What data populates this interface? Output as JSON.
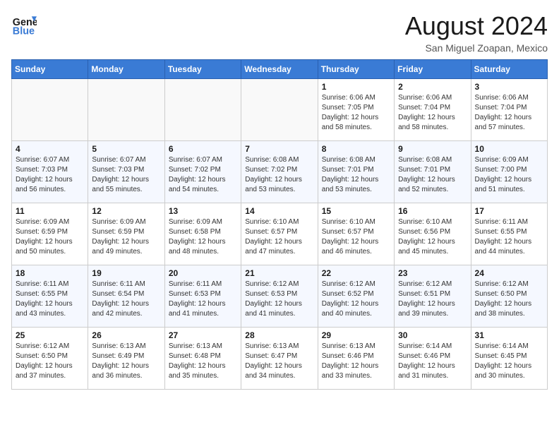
{
  "header": {
    "logo_line1": "General",
    "logo_line2": "Blue",
    "month_year": "August 2024",
    "location": "San Miguel Zoapan, Mexico"
  },
  "weekdays": [
    "Sunday",
    "Monday",
    "Tuesday",
    "Wednesday",
    "Thursday",
    "Friday",
    "Saturday"
  ],
  "weeks": [
    [
      {
        "day": "",
        "empty": true
      },
      {
        "day": "",
        "empty": true
      },
      {
        "day": "",
        "empty": true
      },
      {
        "day": "",
        "empty": true
      },
      {
        "day": "1",
        "sunrise": "6:06 AM",
        "sunset": "7:05 PM",
        "daylight": "12 hours and 58 minutes."
      },
      {
        "day": "2",
        "sunrise": "6:06 AM",
        "sunset": "7:04 PM",
        "daylight": "12 hours and 58 minutes."
      },
      {
        "day": "3",
        "sunrise": "6:06 AM",
        "sunset": "7:04 PM",
        "daylight": "12 hours and 57 minutes."
      }
    ],
    [
      {
        "day": "4",
        "sunrise": "6:07 AM",
        "sunset": "7:03 PM",
        "daylight": "12 hours and 56 minutes."
      },
      {
        "day": "5",
        "sunrise": "6:07 AM",
        "sunset": "7:03 PM",
        "daylight": "12 hours and 55 minutes."
      },
      {
        "day": "6",
        "sunrise": "6:07 AM",
        "sunset": "7:02 PM",
        "daylight": "12 hours and 54 minutes."
      },
      {
        "day": "7",
        "sunrise": "6:08 AM",
        "sunset": "7:02 PM",
        "daylight": "12 hours and 53 minutes."
      },
      {
        "day": "8",
        "sunrise": "6:08 AM",
        "sunset": "7:01 PM",
        "daylight": "12 hours and 53 minutes."
      },
      {
        "day": "9",
        "sunrise": "6:08 AM",
        "sunset": "7:01 PM",
        "daylight": "12 hours and 52 minutes."
      },
      {
        "day": "10",
        "sunrise": "6:09 AM",
        "sunset": "7:00 PM",
        "daylight": "12 hours and 51 minutes."
      }
    ],
    [
      {
        "day": "11",
        "sunrise": "6:09 AM",
        "sunset": "6:59 PM",
        "daylight": "12 hours and 50 minutes."
      },
      {
        "day": "12",
        "sunrise": "6:09 AM",
        "sunset": "6:59 PM",
        "daylight": "12 hours and 49 minutes."
      },
      {
        "day": "13",
        "sunrise": "6:09 AM",
        "sunset": "6:58 PM",
        "daylight": "12 hours and 48 minutes."
      },
      {
        "day": "14",
        "sunrise": "6:10 AM",
        "sunset": "6:57 PM",
        "daylight": "12 hours and 47 minutes."
      },
      {
        "day": "15",
        "sunrise": "6:10 AM",
        "sunset": "6:57 PM",
        "daylight": "12 hours and 46 minutes."
      },
      {
        "day": "16",
        "sunrise": "6:10 AM",
        "sunset": "6:56 PM",
        "daylight": "12 hours and 45 minutes."
      },
      {
        "day": "17",
        "sunrise": "6:11 AM",
        "sunset": "6:55 PM",
        "daylight": "12 hours and 44 minutes."
      }
    ],
    [
      {
        "day": "18",
        "sunrise": "6:11 AM",
        "sunset": "6:55 PM",
        "daylight": "12 hours and 43 minutes."
      },
      {
        "day": "19",
        "sunrise": "6:11 AM",
        "sunset": "6:54 PM",
        "daylight": "12 hours and 42 minutes."
      },
      {
        "day": "20",
        "sunrise": "6:11 AM",
        "sunset": "6:53 PM",
        "daylight": "12 hours and 41 minutes."
      },
      {
        "day": "21",
        "sunrise": "6:12 AM",
        "sunset": "6:53 PM",
        "daylight": "12 hours and 41 minutes."
      },
      {
        "day": "22",
        "sunrise": "6:12 AM",
        "sunset": "6:52 PM",
        "daylight": "12 hours and 40 minutes."
      },
      {
        "day": "23",
        "sunrise": "6:12 AM",
        "sunset": "6:51 PM",
        "daylight": "12 hours and 39 minutes."
      },
      {
        "day": "24",
        "sunrise": "6:12 AM",
        "sunset": "6:50 PM",
        "daylight": "12 hours and 38 minutes."
      }
    ],
    [
      {
        "day": "25",
        "sunrise": "6:12 AM",
        "sunset": "6:50 PM",
        "daylight": "12 hours and 37 minutes."
      },
      {
        "day": "26",
        "sunrise": "6:13 AM",
        "sunset": "6:49 PM",
        "daylight": "12 hours and 36 minutes."
      },
      {
        "day": "27",
        "sunrise": "6:13 AM",
        "sunset": "6:48 PM",
        "daylight": "12 hours and 35 minutes."
      },
      {
        "day": "28",
        "sunrise": "6:13 AM",
        "sunset": "6:47 PM",
        "daylight": "12 hours and 34 minutes."
      },
      {
        "day": "29",
        "sunrise": "6:13 AM",
        "sunset": "6:46 PM",
        "daylight": "12 hours and 33 minutes."
      },
      {
        "day": "30",
        "sunrise": "6:14 AM",
        "sunset": "6:46 PM",
        "daylight": "12 hours and 31 minutes."
      },
      {
        "day": "31",
        "sunrise": "6:14 AM",
        "sunset": "6:45 PM",
        "daylight": "12 hours and 30 minutes."
      }
    ]
  ],
  "labels": {
    "sunrise": "Sunrise:",
    "sunset": "Sunset:",
    "daylight": "Daylight:"
  }
}
